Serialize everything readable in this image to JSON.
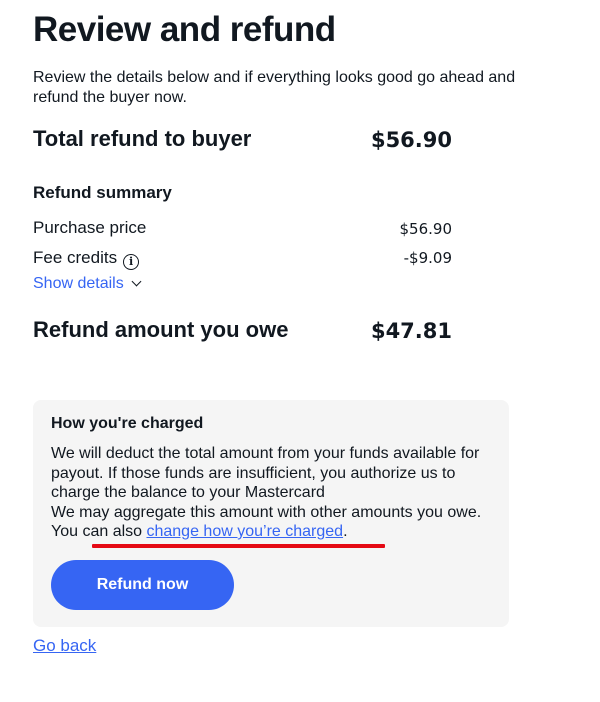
{
  "page": {
    "title": "Review and refund",
    "intro": "Review the details below and if everything looks good go ahead and refund the buyer now."
  },
  "total": {
    "label": "Total refund to buyer",
    "value": "$56.90"
  },
  "summary": {
    "heading": "Refund summary",
    "purchase_price": {
      "label": "Purchase price",
      "value": "$56.90"
    },
    "fee_credits": {
      "label": "Fee credits",
      "value": "-$9.09",
      "icon": "info-icon"
    },
    "show_details": "Show details"
  },
  "owe": {
    "label": "Refund amount you owe",
    "value": "$47.81"
  },
  "charged": {
    "heading": "How you're charged",
    "paragraph1": "We will deduct the total amount from your funds available for payout. If those funds are insufficient, you authorize us to charge the balance to your Mastercard",
    "paragraph2_text": "We may aggregate this amount with other amounts you owe. You can also ",
    "paragraph2_link": "change how you’re charged",
    "paragraph2_end": "."
  },
  "actions": {
    "refund_button": "Refund now",
    "go_back": "Go back"
  },
  "colors": {
    "accent": "#3665f3",
    "annotation_underline": "#e50914",
    "panel_bg": "#f5f5f5",
    "text": "#111820"
  }
}
